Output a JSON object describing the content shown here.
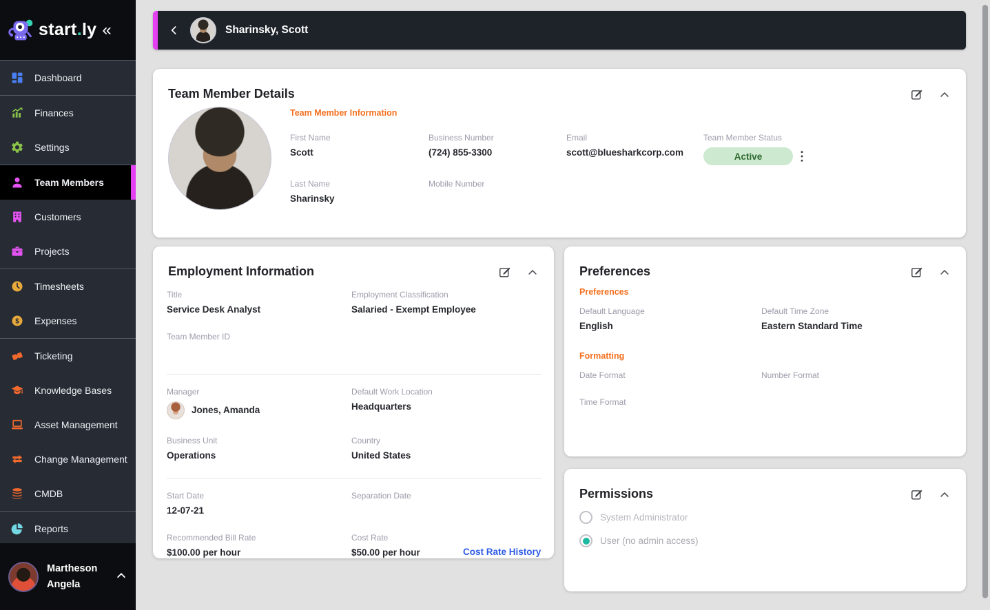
{
  "brand": {
    "name_start": "start",
    "name_dot": ".",
    "name_end": "ly",
    "collapse_icon": "«"
  },
  "colors": {
    "accent_magenta": "#e240f0",
    "accent_orange": "#f4701f",
    "link_blue": "#2f5ce5",
    "badge_green_bg": "#cde9cf",
    "badge_green_text": "#2c682f",
    "radio_teal": "#1db9a2",
    "sidebar_bg": "#272c34",
    "header_bar_bg": "#1e2329",
    "content_bg": "#e1e1e1"
  },
  "icons": {
    "edit": "edit-square-icon",
    "collapse": "chevron-up-icon",
    "kebab": "kebab-menu-icon",
    "back": "chevron-left-icon",
    "sidebar_collapse": "double-chevron-left-icon",
    "logo": "robot-icon"
  },
  "sidebar": {
    "items": [
      {
        "label": "Dashboard",
        "icon": "dashboard-grid-icon",
        "color": "#4a7df0",
        "active": false
      },
      {
        "label": "Finances",
        "icon": "bar-chart-icon",
        "color": "#8bc34a",
        "active": false
      },
      {
        "label": "Settings",
        "icon": "gear-icon",
        "color": "#8bc34a",
        "active": false
      },
      {
        "label": "Team Members",
        "icon": "person-icon",
        "color": "#e554f2",
        "active": true
      },
      {
        "label": "Customers",
        "icon": "building-icon",
        "color": "#e554f2",
        "active": false
      },
      {
        "label": "Projects",
        "icon": "briefcase-icon",
        "color": "#e554f2",
        "active": false
      },
      {
        "label": "Timesheets",
        "icon": "clock-icon",
        "color": "#e7a93c",
        "active": false
      },
      {
        "label": "Expenses",
        "icon": "dollar-coin-icon",
        "color": "#e7a93c",
        "active": false
      },
      {
        "label": "Ticketing",
        "icon": "ticket-icon",
        "color": "#f2692e",
        "active": false
      },
      {
        "label": "Knowledge Bases",
        "icon": "graduation-cap-icon",
        "color": "#f2692e",
        "active": false
      },
      {
        "label": "Asset Management",
        "icon": "laptop-icon",
        "color": "#f2692e",
        "active": false
      },
      {
        "label": "Change Management",
        "icon": "swap-arrows-icon",
        "color": "#f2692e",
        "active": false
      },
      {
        "label": "CMDB",
        "icon": "database-icon",
        "color": "#f2692e",
        "active": false
      },
      {
        "label": "Reports",
        "icon": "pie-chart-icon",
        "color": "#74d8e4",
        "active": false
      }
    ],
    "user": {
      "first_line": "Martheson",
      "second_line": "Angela"
    }
  },
  "header": {
    "title": "Sharinsky, Scott"
  },
  "team_details": {
    "title": "Team Member Details",
    "section": "Team Member Information",
    "first_name": {
      "label": "First Name",
      "value": "Scott"
    },
    "last_name": {
      "label": "Last Name",
      "value": "Sharinsky"
    },
    "business_number": {
      "label": "Business Number",
      "value": "(724) 855-3300"
    },
    "mobile_number": {
      "label": "Mobile Number",
      "value": ""
    },
    "email": {
      "label": "Email",
      "value": "scott@bluesharkcorp.com"
    },
    "status": {
      "label": "Team Member Status",
      "value": "Active"
    }
  },
  "employment": {
    "title": "Employment Information",
    "job_title": {
      "label": "Title",
      "value": "Service Desk Analyst"
    },
    "classification": {
      "label": "Employment Classification",
      "value": "Salaried - Exempt Employee"
    },
    "team_member_id": {
      "label": "Team Member ID",
      "value": ""
    },
    "manager": {
      "label": "Manager",
      "value": "Jones, Amanda"
    },
    "work_location": {
      "label": "Default Work Location",
      "value": "Headquarters"
    },
    "business_unit": {
      "label": "Business Unit",
      "value": "Operations"
    },
    "country": {
      "label": "Country",
      "value": "United States"
    },
    "start_date": {
      "label": "Start Date",
      "value": "12-07-21"
    },
    "separation_date": {
      "label": "Separation Date",
      "value": ""
    },
    "bill_rate": {
      "label": "Recommended Bill Rate",
      "value": "$100.00 per hour"
    },
    "cost_rate": {
      "label": "Cost Rate",
      "value": "$50.00 per hour"
    },
    "cost_rate_history": "Cost Rate History"
  },
  "preferences": {
    "title": "Preferences",
    "section_preferences": "Preferences",
    "section_formatting": "Formatting",
    "default_language": {
      "label": "Default Language",
      "value": "English"
    },
    "default_time_zone": {
      "label": "Default Time Zone",
      "value": "Eastern Standard Time"
    },
    "date_format": {
      "label": "Date Format",
      "value": ""
    },
    "number_format": {
      "label": "Number Format",
      "value": ""
    },
    "time_format": {
      "label": "Time Format",
      "value": ""
    }
  },
  "permissions": {
    "title": "Permissions",
    "options": [
      {
        "label": "System Administrator",
        "selected": false
      },
      {
        "label": "User (no admin access)",
        "selected": true
      }
    ]
  }
}
